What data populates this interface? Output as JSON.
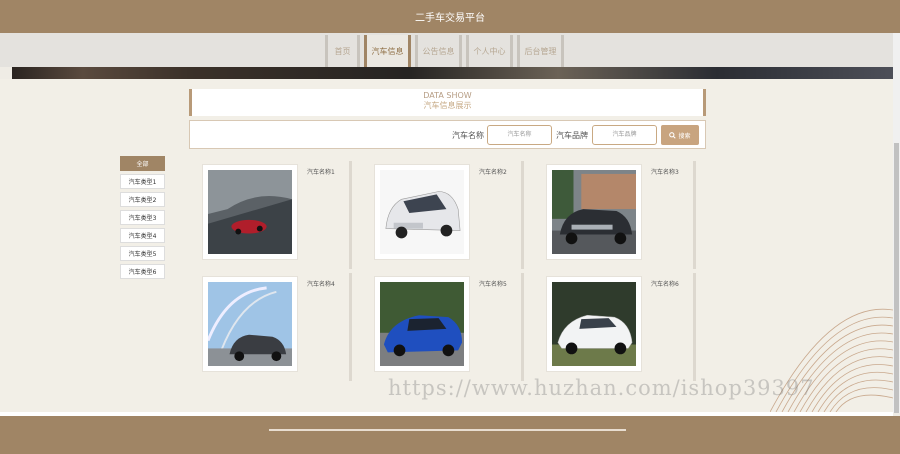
{
  "header": {
    "title": "二手车交易平台"
  },
  "nav": [
    {
      "label": "首页",
      "active": false
    },
    {
      "label": "汽车信息",
      "active": true
    },
    {
      "label": "公告信息",
      "active": false
    },
    {
      "label": "个人中心",
      "active": false
    },
    {
      "label": "后台管理",
      "active": false
    }
  ],
  "section": {
    "title_en": "DATA SHOW",
    "title_cn": "汽车信息展示"
  },
  "search": {
    "name_label": "汽车名称",
    "name_placeholder": "汽车名称",
    "brand_label": "汽车品牌",
    "brand_placeholder": "汽车品牌",
    "button_label": "搜索",
    "button_icon": "search-icon"
  },
  "categories": [
    "全部",
    "汽车类型1",
    "汽车类型2",
    "汽车类型3",
    "汽车类型4",
    "汽车类型5",
    "汽车类型6"
  ],
  "cars": [
    {
      "name": "汽车名称1"
    },
    {
      "name": "汽车名称2"
    },
    {
      "name": "汽车名称3"
    },
    {
      "name": "汽车名称4"
    },
    {
      "name": "汽车名称5"
    },
    {
      "name": "汽车名称6"
    }
  ],
  "watermark": "https://www.huzhan.com/ishop39397",
  "colors": {
    "brand": "#a08565",
    "accent": "#c8a47f",
    "background": "#efece5"
  }
}
